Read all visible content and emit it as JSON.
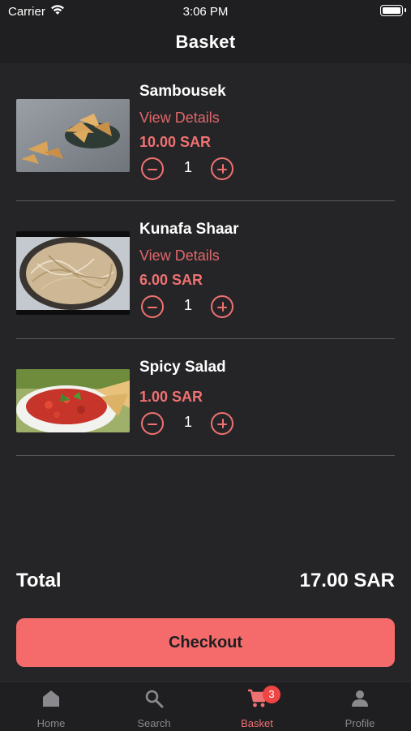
{
  "status_bar": {
    "carrier": "Carrier",
    "time": "3:06 PM"
  },
  "header": {
    "title": "Basket"
  },
  "basket": {
    "items": [
      {
        "name": "Sambousek",
        "details_link": "View Details",
        "price": "10.00 SAR",
        "quantity": "1"
      },
      {
        "name": "Kunafa Shaar",
        "details_link": "View Details",
        "price": "6.00 SAR",
        "quantity": "1"
      },
      {
        "name": "Spicy Salad",
        "price": "1.00 SAR",
        "quantity": "1"
      }
    ]
  },
  "summary": {
    "total_label": "Total",
    "total_value": "17.00 SAR"
  },
  "checkout": {
    "label": "Checkout"
  },
  "tab_bar": {
    "tabs": [
      {
        "label": "Home",
        "icon": "home-icon"
      },
      {
        "label": "Search",
        "icon": "search-icon"
      },
      {
        "label": "Basket",
        "icon": "cart-icon",
        "badge": "3"
      },
      {
        "label": "Profile",
        "icon": "profile-icon"
      }
    ],
    "active": "Basket"
  },
  "colors": {
    "accent": "#f07172",
    "button": "#f56b6b",
    "background": "#252527",
    "bar": "#1f1f21"
  }
}
